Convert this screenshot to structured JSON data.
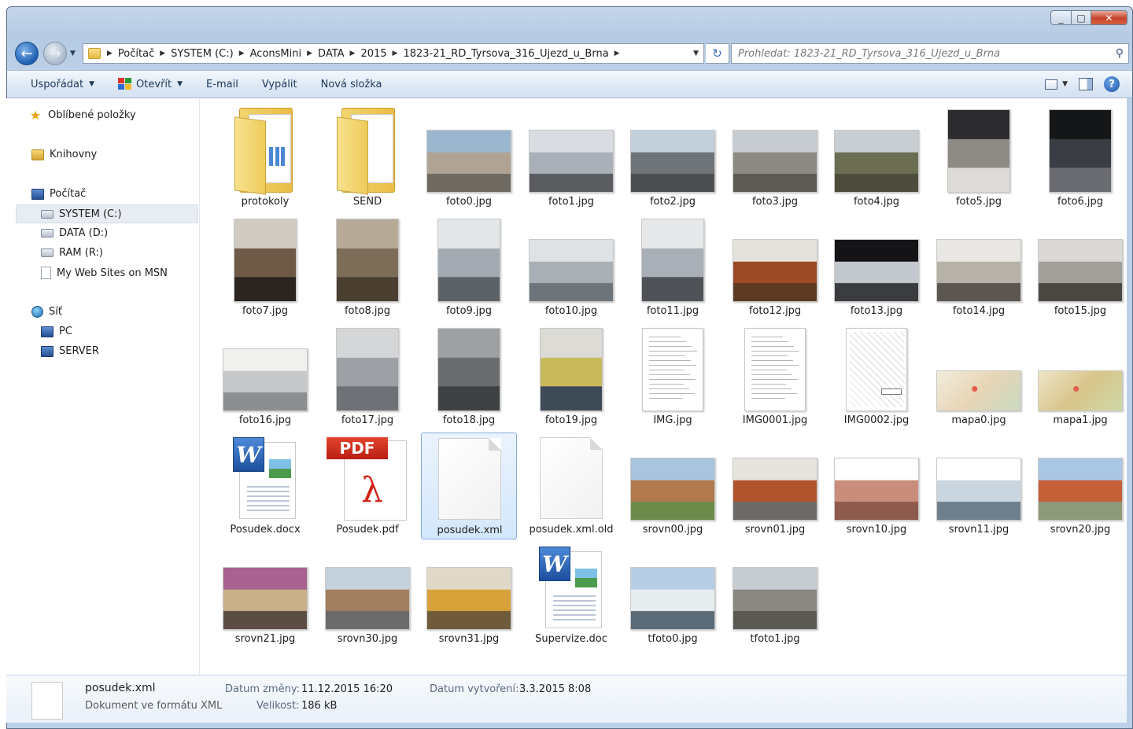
{
  "window": {
    "minimize": "_",
    "maximize": "□",
    "close": "✕"
  },
  "address": {
    "crumbs": [
      "Počítač",
      "SYSTEM (C:)",
      "AconsMini",
      "DATA",
      "2015",
      "1823-21_RD_Tyrsova_316_Ujezd_u_Brna"
    ],
    "search_placeholder": "Prohledat: 1823-21_RD_Tyrsova_316_Ujezd_u_Brna"
  },
  "toolbar": {
    "organize": "Uspořádat",
    "open": "Otevřít",
    "email": "E-mail",
    "burn": "Vypálit",
    "new_folder": "Nová složka"
  },
  "sidebar": {
    "favorites": "Oblíbené položky",
    "libraries": "Knihovny",
    "computer": "Počítač",
    "drives": [
      "SYSTEM (C:)",
      "DATA (D:)",
      "RAM (R:)",
      "My Web Sites on MSN"
    ],
    "network": "Síť",
    "network_items": [
      "PC",
      "SERVER"
    ]
  },
  "files": [
    {
      "name": "protokoly",
      "kind": "folder-excel"
    },
    {
      "name": "SEND",
      "kind": "folder"
    },
    {
      "name": "foto0.jpg",
      "kind": "land",
      "colors": [
        "#9bb7cf",
        "#b0a394",
        "#6e6a61"
      ]
    },
    {
      "name": "foto1.jpg",
      "kind": "land",
      "colors": [
        "#d9dde2",
        "#a9b0b8",
        "#5a5c60"
      ]
    },
    {
      "name": "foto2.jpg",
      "kind": "land",
      "colors": [
        "#c2d0dc",
        "#6f7478",
        "#4c4f52"
      ]
    },
    {
      "name": "foto3.jpg",
      "kind": "land",
      "colors": [
        "#c7ccd0",
        "#8c8a83",
        "#5d5a53"
      ]
    },
    {
      "name": "foto4.jpg",
      "kind": "land",
      "colors": [
        "#c9ced3",
        "#6b6e52",
        "#4d4b3c"
      ]
    },
    {
      "name": "foto5.jpg",
      "kind": "port",
      "colors": [
        "#2c2c2e",
        "#8e8a86",
        "#dcdbd8"
      ]
    },
    {
      "name": "foto6.jpg",
      "kind": "port",
      "colors": [
        "#151618",
        "#3b3d44",
        "#6a6c72"
      ]
    },
    {
      "name": "foto7.jpg",
      "kind": "port",
      "colors": [
        "#cfcbc2",
        "#6e5a46",
        "#2c2421"
      ]
    },
    {
      "name": "foto8.jpg",
      "kind": "port",
      "colors": [
        "#b7ab98",
        "#7d6d58",
        "#4b3f32"
      ]
    },
    {
      "name": "foto9.jpg",
      "kind": "port",
      "colors": [
        "#e3e6e8",
        "#a3aab1",
        "#5d6267"
      ]
    },
    {
      "name": "foto10.jpg",
      "kind": "land",
      "colors": [
        "#dfe2e4",
        "#a8b0b6",
        "#6d757b"
      ]
    },
    {
      "name": "foto11.jpg",
      "kind": "port",
      "colors": [
        "#e6e8ea",
        "#a8afb6",
        "#4f5357"
      ]
    },
    {
      "name": "foto12.jpg",
      "kind": "land",
      "colors": [
        "#e5e2dc",
        "#9c4a26",
        "#5e3a22"
      ]
    },
    {
      "name": "foto13.jpg",
      "kind": "land",
      "colors": [
        "#141416",
        "#c3c8cf",
        "#3b3c40"
      ]
    },
    {
      "name": "foto14.jpg",
      "kind": "land",
      "colors": [
        "#e8e7e4",
        "#b7b2a7",
        "#5b5650"
      ]
    },
    {
      "name": "foto15.jpg",
      "kind": "land",
      "colors": [
        "#d9d8d4",
        "#a2a09a",
        "#4b4844"
      ]
    },
    {
      "name": "foto16.jpg",
      "kind": "land",
      "colors": [
        "#f0f0ef",
        "#c6c8ca",
        "#8c8e90"
      ]
    },
    {
      "name": "foto17.jpg",
      "kind": "port",
      "colors": [
        "#d4d6d8",
        "#9da1a5",
        "#6e7276"
      ]
    },
    {
      "name": "foto18.jpg",
      "kind": "port",
      "colors": [
        "#9ea1a3",
        "#6a6d70",
        "#3f4244"
      ]
    },
    {
      "name": "foto19.jpg",
      "kind": "port",
      "colors": [
        "#dcdbd5",
        "#c7b85a",
        "#3f4a57"
      ]
    },
    {
      "name": "IMG.jpg",
      "kind": "doc"
    },
    {
      "name": "IMG0001.jpg",
      "kind": "doc"
    },
    {
      "name": "IMG0002.jpg",
      "kind": "docmap"
    },
    {
      "name": "mapa0.jpg",
      "kind": "map",
      "colors": [
        "#f1ecdc",
        "#e8d6b6",
        "#c9d9c0"
      ]
    },
    {
      "name": "mapa1.jpg",
      "kind": "map",
      "colors": [
        "#eee6c9",
        "#d9c58a",
        "#cfd8a8"
      ]
    },
    {
      "name": "Posudek.docx",
      "kind": "word"
    },
    {
      "name": "Posudek.pdf",
      "kind": "pdf",
      "tag": "PDF"
    },
    {
      "name": "posudek.xml",
      "kind": "blank",
      "selected": true
    },
    {
      "name": "posudek.xml.old",
      "kind": "blank"
    },
    {
      "name": "srovn00.jpg",
      "kind": "land",
      "colors": [
        "#a9c4de",
        "#b07a4c",
        "#6c8a4a"
      ]
    },
    {
      "name": "srovn01.jpg",
      "kind": "land",
      "colors": [
        "#e7e4de",
        "#b1532d",
        "#6c6a66"
      ]
    },
    {
      "name": "srovn10.jpg",
      "kind": "land",
      "colors": [
        "#ffffff",
        "#c98d7c",
        "#8d5a4b"
      ]
    },
    {
      "name": "srovn11.jpg",
      "kind": "land",
      "colors": [
        "#ffffff",
        "#c9d6e0",
        "#6e7f8d"
      ]
    },
    {
      "name": "srovn20.jpg",
      "kind": "land",
      "colors": [
        "#a9c7e4",
        "#c45f38",
        "#8f9a7a"
      ]
    },
    {
      "name": "srovn21.jpg",
      "kind": "land",
      "colors": [
        "#a7628f",
        "#c9b08a",
        "#5c4d44"
      ]
    },
    {
      "name": "srovn30.jpg",
      "kind": "land",
      "colors": [
        "#c5d2dd",
        "#a27f5f",
        "#6b6b6b"
      ]
    },
    {
      "name": "srovn31.jpg",
      "kind": "land",
      "colors": [
        "#e0d9c8",
        "#d7a23a",
        "#6f5a3a"
      ]
    },
    {
      "name": "Supervize.doc",
      "kind": "word"
    },
    {
      "name": "tfoto0.jpg",
      "kind": "land",
      "colors": [
        "#b7cfe4",
        "#e7ecef",
        "#5b6b78"
      ]
    },
    {
      "name": "tfoto1.jpg",
      "kind": "land",
      "colors": [
        "#c5ccd2",
        "#8a8882",
        "#5b5954"
      ]
    }
  ],
  "details": {
    "name": "posudek.xml",
    "type": "Dokument ve formátu XML",
    "modified_label": "Datum změny:",
    "modified_value": "11.12.2015 16:20",
    "size_label": "Velikost:",
    "size_value": "186 kB",
    "created_label": "Datum vytvoření:",
    "created_value": "3.3.2015 8:08"
  }
}
